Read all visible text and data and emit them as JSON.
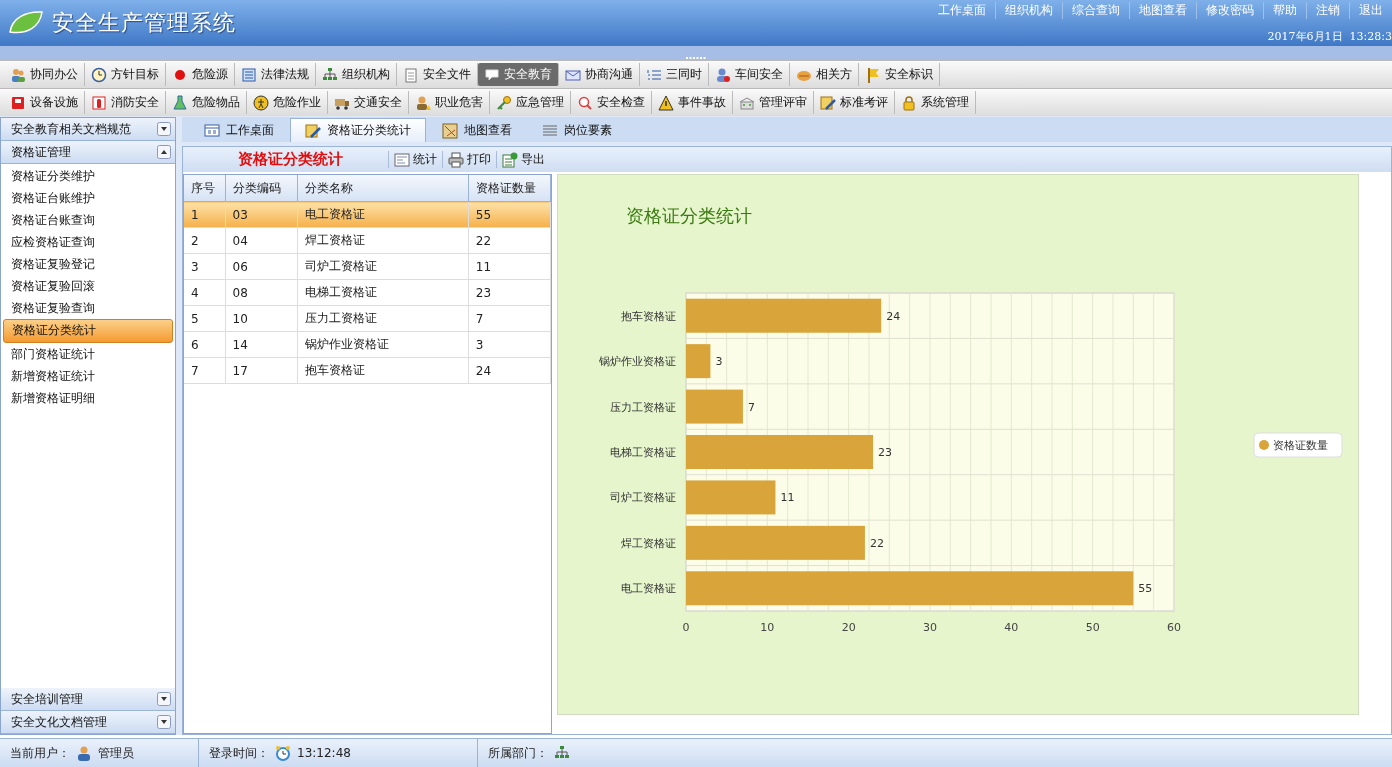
{
  "header": {
    "title": "安全生产管理系统",
    "links": [
      "工作桌面",
      "组织机构",
      "综合查询",
      "地图查看",
      "修改密码",
      "帮助",
      "注销",
      "退出"
    ],
    "datetime": "2017年6月1日  13:28:3"
  },
  "toolbar_rows": [
    [
      {
        "label": "协同办公",
        "selected": false
      },
      {
        "label": "方针目标",
        "selected": false
      },
      {
        "label": "危险源",
        "selected": false
      },
      {
        "label": "法律法规",
        "selected": false
      },
      {
        "label": "组织机构",
        "selected": false
      },
      {
        "label": "安全文件",
        "selected": false
      },
      {
        "label": "安全教育",
        "selected": true
      },
      {
        "label": "协商沟通",
        "selected": false
      },
      {
        "label": "三同时",
        "selected": false
      },
      {
        "label": "车间安全",
        "selected": false
      },
      {
        "label": "相关方",
        "selected": false
      },
      {
        "label": "安全标识",
        "selected": false
      }
    ],
    [
      {
        "label": "设备设施",
        "selected": false
      },
      {
        "label": "消防安全",
        "selected": false
      },
      {
        "label": "危险物品",
        "selected": false
      },
      {
        "label": "危险作业",
        "selected": false
      },
      {
        "label": "交通安全",
        "selected": false
      },
      {
        "label": "职业危害",
        "selected": false
      },
      {
        "label": "应急管理",
        "selected": false
      },
      {
        "label": "安全检查",
        "selected": false
      },
      {
        "label": "事件事故",
        "selected": false
      },
      {
        "label": "管理评审",
        "selected": false
      },
      {
        "label": "标准考评",
        "selected": false
      },
      {
        "label": "系统管理",
        "selected": false
      }
    ]
  ],
  "sidebar": {
    "sections": [
      {
        "title": "安全教育相关文档规范",
        "expanded": false
      },
      {
        "title": "资格证管理",
        "expanded": true,
        "items": [
          {
            "label": "资格证分类维护",
            "selected": false
          },
          {
            "label": "资格证台账维护",
            "selected": false
          },
          {
            "label": "资格证台账查询",
            "selected": false
          },
          {
            "label": "应检资格证查询",
            "selected": false
          },
          {
            "label": "资格证复验登记",
            "selected": false
          },
          {
            "label": "资格证复验回滚",
            "selected": false
          },
          {
            "label": "资格证复验查询",
            "selected": false
          },
          {
            "label": "资格证分类统计",
            "selected": true
          },
          {
            "label": "部门资格证统计",
            "selected": false
          },
          {
            "label": "新增资格证统计",
            "selected": false
          },
          {
            "label": "新增资格证明细",
            "selected": false
          }
        ]
      },
      {
        "title": "安全培训管理",
        "expanded": false
      },
      {
        "title": "安全文化文档管理",
        "expanded": false
      }
    ]
  },
  "tabs": [
    {
      "label": "工作桌面",
      "selected": false
    },
    {
      "label": "资格证分类统计",
      "selected": true
    },
    {
      "label": "地图查看",
      "selected": false
    },
    {
      "label": "岗位要素",
      "selected": false
    }
  ],
  "panel": {
    "title": "资格证分类统计",
    "buttons": [
      "统计",
      "打印",
      "导出"
    ]
  },
  "table": {
    "columns": [
      "序号",
      "分类编码",
      "分类名称",
      "资格证数量"
    ],
    "rows": [
      {
        "cells": [
          "1",
          "03",
          "电工资格证",
          "55"
        ],
        "selected": true
      },
      {
        "cells": [
          "2",
          "04",
          "焊工资格证",
          "22"
        ],
        "selected": false
      },
      {
        "cells": [
          "3",
          "06",
          "司炉工资格证",
          "11"
        ],
        "selected": false
      },
      {
        "cells": [
          "4",
          "08",
          "电梯工资格证",
          "23"
        ],
        "selected": false
      },
      {
        "cells": [
          "5",
          "10",
          "压力工资格证",
          "7"
        ],
        "selected": false
      },
      {
        "cells": [
          "6",
          "14",
          "锅炉作业资格证",
          "3"
        ],
        "selected": false
      },
      {
        "cells": [
          "7",
          "17",
          "抱车资格证",
          "24"
        ],
        "selected": false
      }
    ]
  },
  "chart": {
    "chart_data": {
      "type": "bar",
      "orientation": "horizontal",
      "title": "资格证分类统计",
      "categories": [
        "抱车资格证",
        "锅炉作业资格证",
        "压力工资格证",
        "电梯工资格证",
        "司炉工资格证",
        "焊工资格证",
        "电工资格证"
      ],
      "series": [
        {
          "name": "资格证数量",
          "color": "#d9a53a",
          "values": [
            24,
            3,
            7,
            23,
            11,
            22,
            55
          ]
        }
      ],
      "xlim": [
        0,
        60
      ],
      "xticks": [
        0,
        10,
        20,
        30,
        40,
        50,
        60
      ],
      "grid": true,
      "data_labels": true
    }
  },
  "status_bar": {
    "user_label": "当前用户：",
    "user": "管理员",
    "login_label": "登录时间：",
    "login_time": "13:12:48",
    "dept_label": "所属部门："
  }
}
